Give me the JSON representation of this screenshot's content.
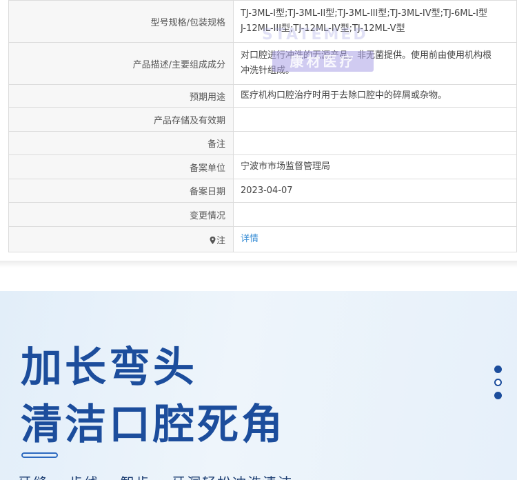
{
  "table": {
    "rows": [
      {
        "label": "型号规格/包装规格",
        "value_lines": [
          "TJ-3ML-I型;TJ-3ML-II型;TJ-3ML-III型;TJ-3ML-IV型;TJ-6ML-I型",
          "J-12ML-III型;TJ-12ML-IV型;TJ-12ML-V型"
        ]
      },
      {
        "label": "产品描述/主要组成成分",
        "value_lines": [
          "对口腔进行冲洗的无源产品。非无菌提供。使用前由使用机构根",
          "冲洗针组成。"
        ]
      },
      {
        "label": "预期用途",
        "value_lines": [
          "医疗机构口腔治疗时用于去除口腔中的碎屑或杂物。"
        ]
      },
      {
        "label": "产品存储及有效期",
        "value_lines": [
          ""
        ]
      },
      {
        "label": "备注",
        "value_lines": [
          ""
        ]
      },
      {
        "label": "备案单位",
        "value_lines": [
          "宁波市市场监督管理局"
        ]
      },
      {
        "label": "备案日期",
        "value_lines": [
          "2023-04-07"
        ]
      },
      {
        "label": "变更情况",
        "value_lines": [
          ""
        ]
      }
    ],
    "note_label": "注",
    "note_link": "详情",
    "pin_icon": "map-pin-icon"
  },
  "watermark": {
    "en": "STATEMED",
    "cn": "康材医疗"
  },
  "hero": {
    "title_line1": "加长弯头",
    "title_line2": "清洁口腔死角",
    "subtitle": "牙缝、 齿线、 智齿、 牙洞轻松冲洗清洁",
    "accent_color": "#1c4d9c"
  }
}
